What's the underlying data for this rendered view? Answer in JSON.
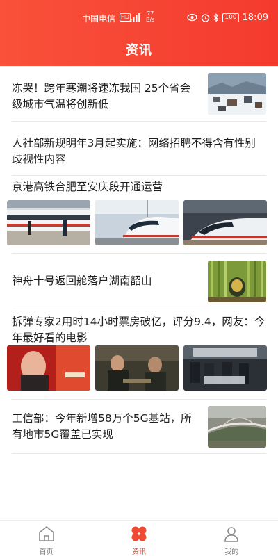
{
  "status_bar": {
    "carrier": "中国电信",
    "hd_badge": "HD",
    "net_speed_value": "77",
    "net_speed_unit": "B/s",
    "battery": "100",
    "time": "18:09"
  },
  "header": {
    "title": "资讯"
  },
  "feed": [
    {
      "title": "冻哭！跨年寒潮将速冻我国 25个省会级城市气温将创新低",
      "thumb": "snow-town-image"
    },
    {
      "title": "人社部新规明年3月起实施：网络招聘不得含有性别歧视性内容"
    },
    {
      "title": "京港高铁合肥至安庆段开通运营",
      "images": [
        "train-platform-image",
        "bullet-train-front-image",
        "bullet-train-station-image"
      ]
    },
    {
      "title": "神舟十号返回舱落户湖南韶山",
      "thumb": "bamboo-forest-image"
    },
    {
      "title": "拆弹专家2用时14小时票房破亿，评分9.4，网友：今年最好看的电影",
      "images": [
        "movie-poster-image",
        "movie-scene-image",
        "imax-poster-image"
      ]
    },
    {
      "title": "工信部：今年新增58万个5G基站，所有地市5G覆盖已实现",
      "thumb": "bridge-aerial-image"
    }
  ],
  "bottom_nav": [
    {
      "label": "首页",
      "icon": "home-icon",
      "active": false
    },
    {
      "label": "资讯",
      "icon": "news-icon",
      "active": true
    },
    {
      "label": "我的",
      "icon": "profile-icon",
      "active": false
    }
  ],
  "colors": {
    "accent": "#f4412e",
    "header_start": "#f9513a",
    "header_end": "#f43a2e"
  }
}
